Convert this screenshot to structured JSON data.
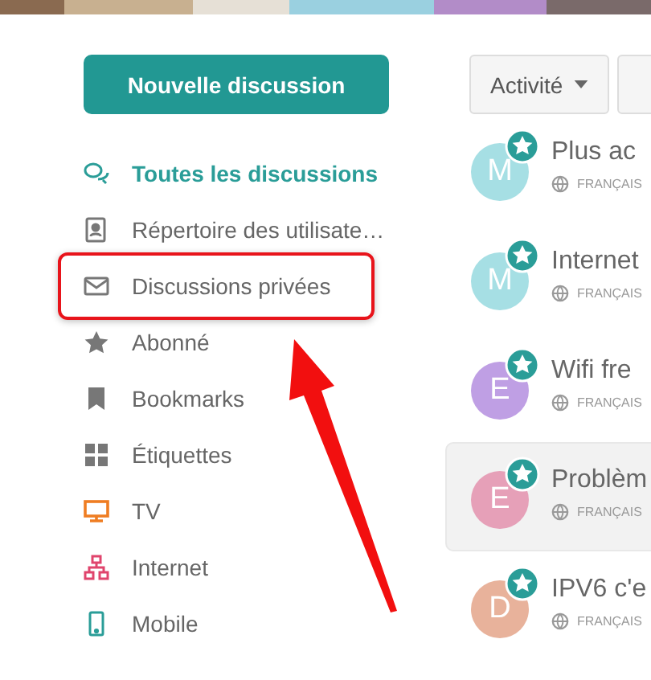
{
  "new_button": "Nouvelle discussion",
  "sidebar": {
    "items": [
      {
        "label": "Toutes les discussions",
        "selected": true,
        "highlighted": false
      },
      {
        "label": "Répertoire des utilisate…",
        "selected": false,
        "highlighted": false
      },
      {
        "label": "Discussions privées",
        "selected": false,
        "highlighted": true
      },
      {
        "label": "Abonné",
        "selected": false,
        "highlighted": false
      },
      {
        "label": "Bookmarks",
        "selected": false,
        "highlighted": false
      },
      {
        "label": "Étiquettes",
        "selected": false,
        "highlighted": false
      },
      {
        "label": "TV",
        "selected": false,
        "highlighted": false
      },
      {
        "label": "Internet",
        "selected": false,
        "highlighted": false
      },
      {
        "label": "Mobile",
        "selected": false,
        "highlighted": false
      }
    ]
  },
  "sort_button": "Activité",
  "discussions": [
    {
      "initial": "M",
      "color": "#a6dfe4",
      "title": "Plus ac",
      "language": "FRANÇAIS",
      "hovered": false
    },
    {
      "initial": "M",
      "color": "#a6dfe4",
      "title": "Internet",
      "language": "FRANÇAIS",
      "hovered": false
    },
    {
      "initial": "E",
      "color": "#bf9fe4",
      "title": "Wifi fre",
      "language": "FRANÇAIS",
      "hovered": false
    },
    {
      "initial": "E",
      "color": "#e6a0b8",
      "title": "Problèm",
      "language": "FRANÇAIS",
      "hovered": true
    },
    {
      "initial": "D",
      "color": "#e8b29b",
      "title": "IPV6 c'e",
      "language": "FRANÇAIS",
      "hovered": false
    }
  ],
  "callout": {
    "kind": "arrow"
  }
}
